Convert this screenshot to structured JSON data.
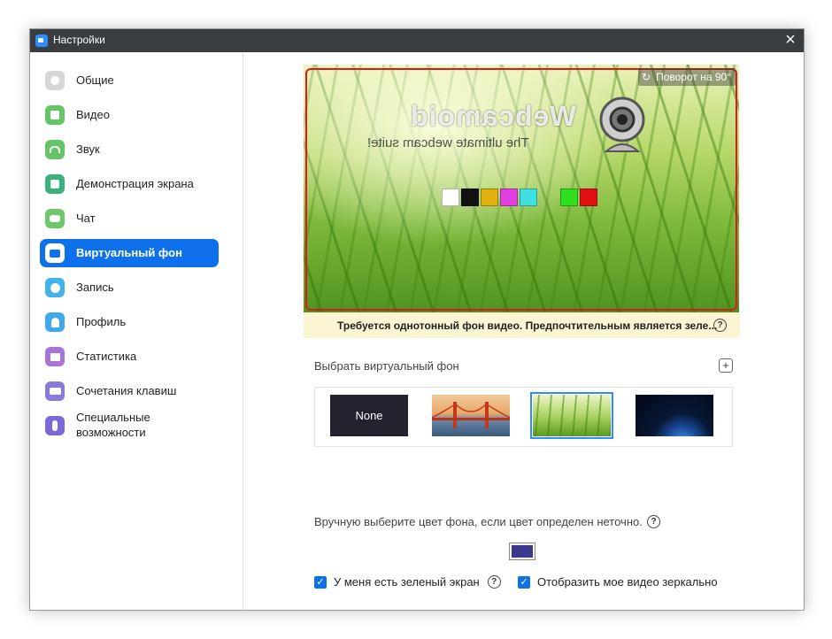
{
  "window": {
    "title": "Настройки",
    "close": "×"
  },
  "sidebar": {
    "items": [
      {
        "label": "Общие",
        "icon": "gear-icon",
        "color": "#d7d7d7"
      },
      {
        "label": "Видео",
        "icon": "video-camera-icon",
        "color": "#65c466"
      },
      {
        "label": "Звук",
        "icon": "headphones-icon",
        "color": "#65c466"
      },
      {
        "label": "Демонстрация экрана",
        "icon": "share-screen-icon",
        "color": "#39b27a"
      },
      {
        "label": "Чат",
        "icon": "chat-bubble-icon",
        "color": "#6ec86b"
      },
      {
        "label": "Виртуальный фон",
        "icon": "person-card-icon",
        "color": "#ffffff",
        "active": true
      },
      {
        "label": "Запись",
        "icon": "record-circle-icon",
        "color": "#3fb3ea"
      },
      {
        "label": "Профиль",
        "icon": "user-icon",
        "color": "#3fa8ea"
      },
      {
        "label": "Статистика",
        "icon": "bar-chart-icon",
        "color": "#a774d9"
      },
      {
        "label": "Сочетания клавиш",
        "icon": "keyboard-icon",
        "color": "#8a7ad9"
      },
      {
        "label_line1": "Специальные",
        "label_line2": "возможности",
        "icon": "accessibility-icon",
        "color": "#7a6ad9"
      }
    ]
  },
  "preview": {
    "rotate_label": "Поворот на 90°",
    "watermark_title": "Webcamoid",
    "watermark_subtitle": "The ultimate webcam suite!",
    "swatches": [
      "#ffffff",
      "#111111",
      "#e0b010",
      "#e040e0",
      "#40e0e0",
      "#30e020",
      "#e01010"
    ]
  },
  "warning": {
    "text": "Требуется однотонный фон видео. Предпочтительным является зеле...",
    "help": "?"
  },
  "background": {
    "label": "Выбрать виртуальный фон",
    "add": "+",
    "thumbs": [
      {
        "label": "None"
      },
      {
        "label": ""
      },
      {
        "label": ""
      },
      {
        "label": ""
      }
    ]
  },
  "manual": {
    "label": "Вручную выберите цвет фона, если цвет определен неточно.",
    "help": "?",
    "color": "#3a3a8c"
  },
  "checks": {
    "green_screen": {
      "label": "У меня есть зеленый экран",
      "checked": true,
      "help": "?"
    },
    "mirror": {
      "label": "Отобразить мое видео зеркально",
      "checked": true
    }
  }
}
